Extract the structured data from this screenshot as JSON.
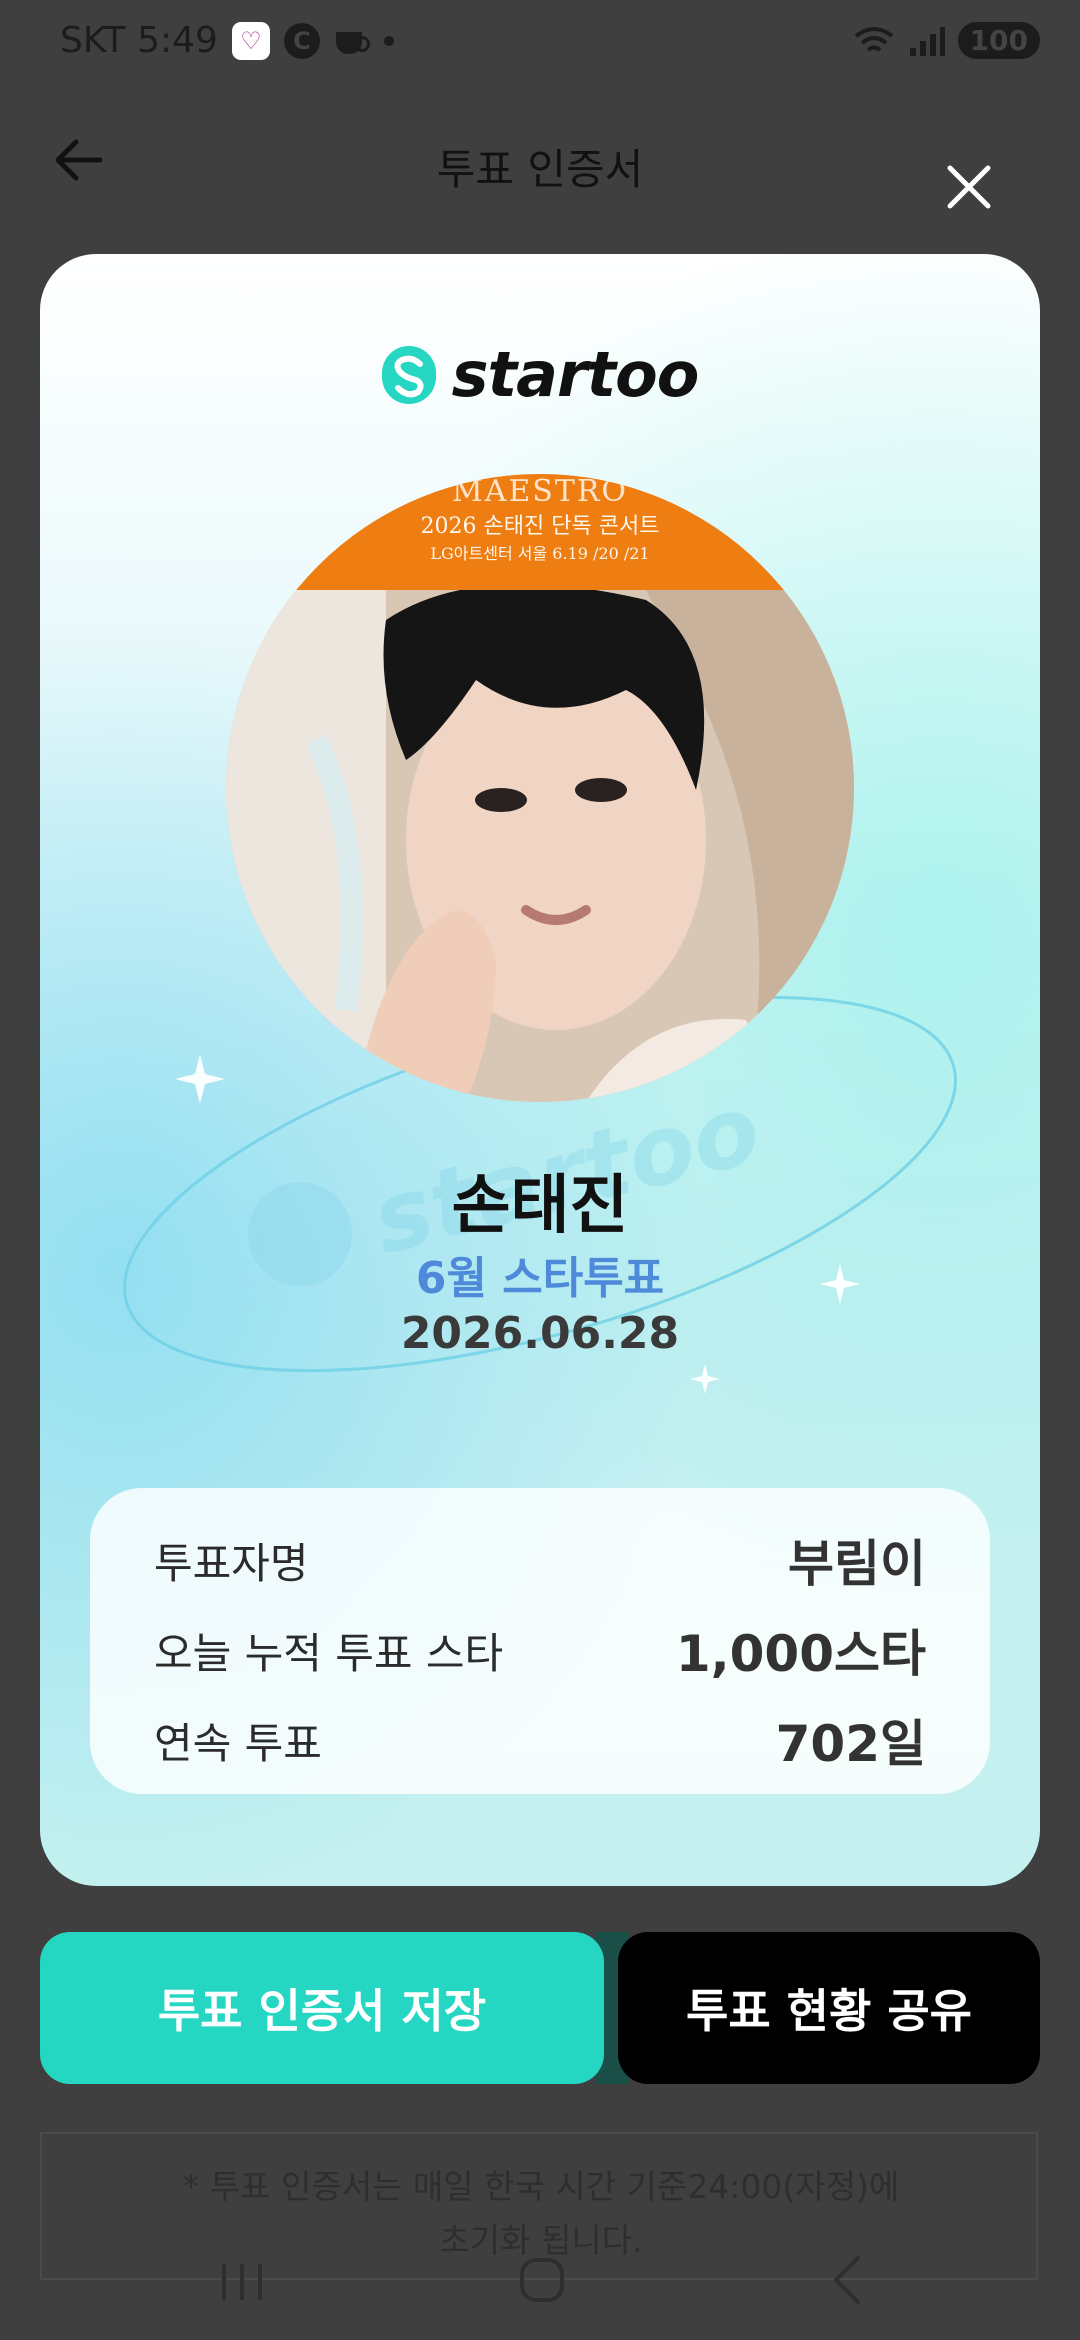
{
  "status_bar": {
    "carrier_time": "SKT 5:49",
    "c_icon_label": "C",
    "battery": "100"
  },
  "header": {
    "title": "투표 인증서"
  },
  "card": {
    "logo_text": "startoo",
    "banner_line1": "MAESTRO",
    "banner_line2": "2026 손태진 단독 콘서트",
    "banner_line3": "LG아트센터 서울 6.19 /20 /21",
    "artist_name": "손태진",
    "vote_title": "6월 스타투표",
    "vote_date": "2026.06.28",
    "stats": [
      {
        "label": "투표자명",
        "value": "부림이"
      },
      {
        "label": "오늘 누적 투표 스타",
        "value": "1,000스타"
      },
      {
        "label": "연속 투표",
        "value": "702일"
      }
    ]
  },
  "buttons": {
    "save": "투표 인증서 저장",
    "share": "투표 현황 공유"
  },
  "notice": {
    "line1": "* 투표 인증서는 매일 한국 시간 기준24:00(자정)에",
    "line2": "초기화 됩니다."
  },
  "colors": {
    "accent": "#25d6c2",
    "vote_title": "#4e8ad9",
    "share_button": "#000000",
    "overlay": "#3f3f3f"
  }
}
